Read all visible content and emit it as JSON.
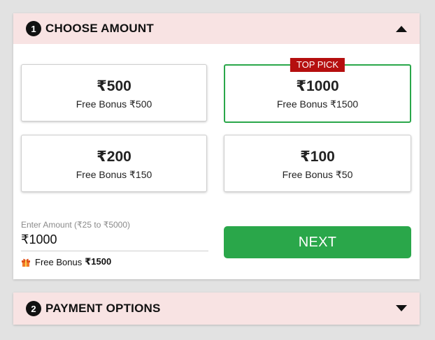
{
  "choose_amount": {
    "step_number": "1",
    "title": "CHOOSE AMOUNT",
    "toggle_icon": "chevron-up-icon",
    "options": [
      {
        "amount": "₹500",
        "bonus": "Free Bonus ₹500",
        "selected": false
      },
      {
        "amount": "₹1000",
        "bonus": "Free Bonus ₹1500",
        "selected": true,
        "badge": "TOP PICK"
      },
      {
        "amount": "₹200",
        "bonus": "Free Bonus ₹150",
        "selected": false
      },
      {
        "amount": "₹100",
        "bonus": "Free Bonus ₹50",
        "selected": false
      }
    ],
    "input": {
      "label": "Enter Amount (₹25 to ₹5000)",
      "value": "₹1000"
    },
    "bonus_info": {
      "icon": "gift-icon",
      "label": "Free Bonus",
      "value": "₹1500"
    },
    "next_label": "NEXT"
  },
  "payment_options": {
    "step_number": "2",
    "title": "PAYMENT OPTIONS",
    "toggle_icon": "chevron-down-icon"
  },
  "colors": {
    "header_bg": "#f8e3e3",
    "accent_green": "#2aa74a",
    "badge_red": "#b50f0f"
  }
}
